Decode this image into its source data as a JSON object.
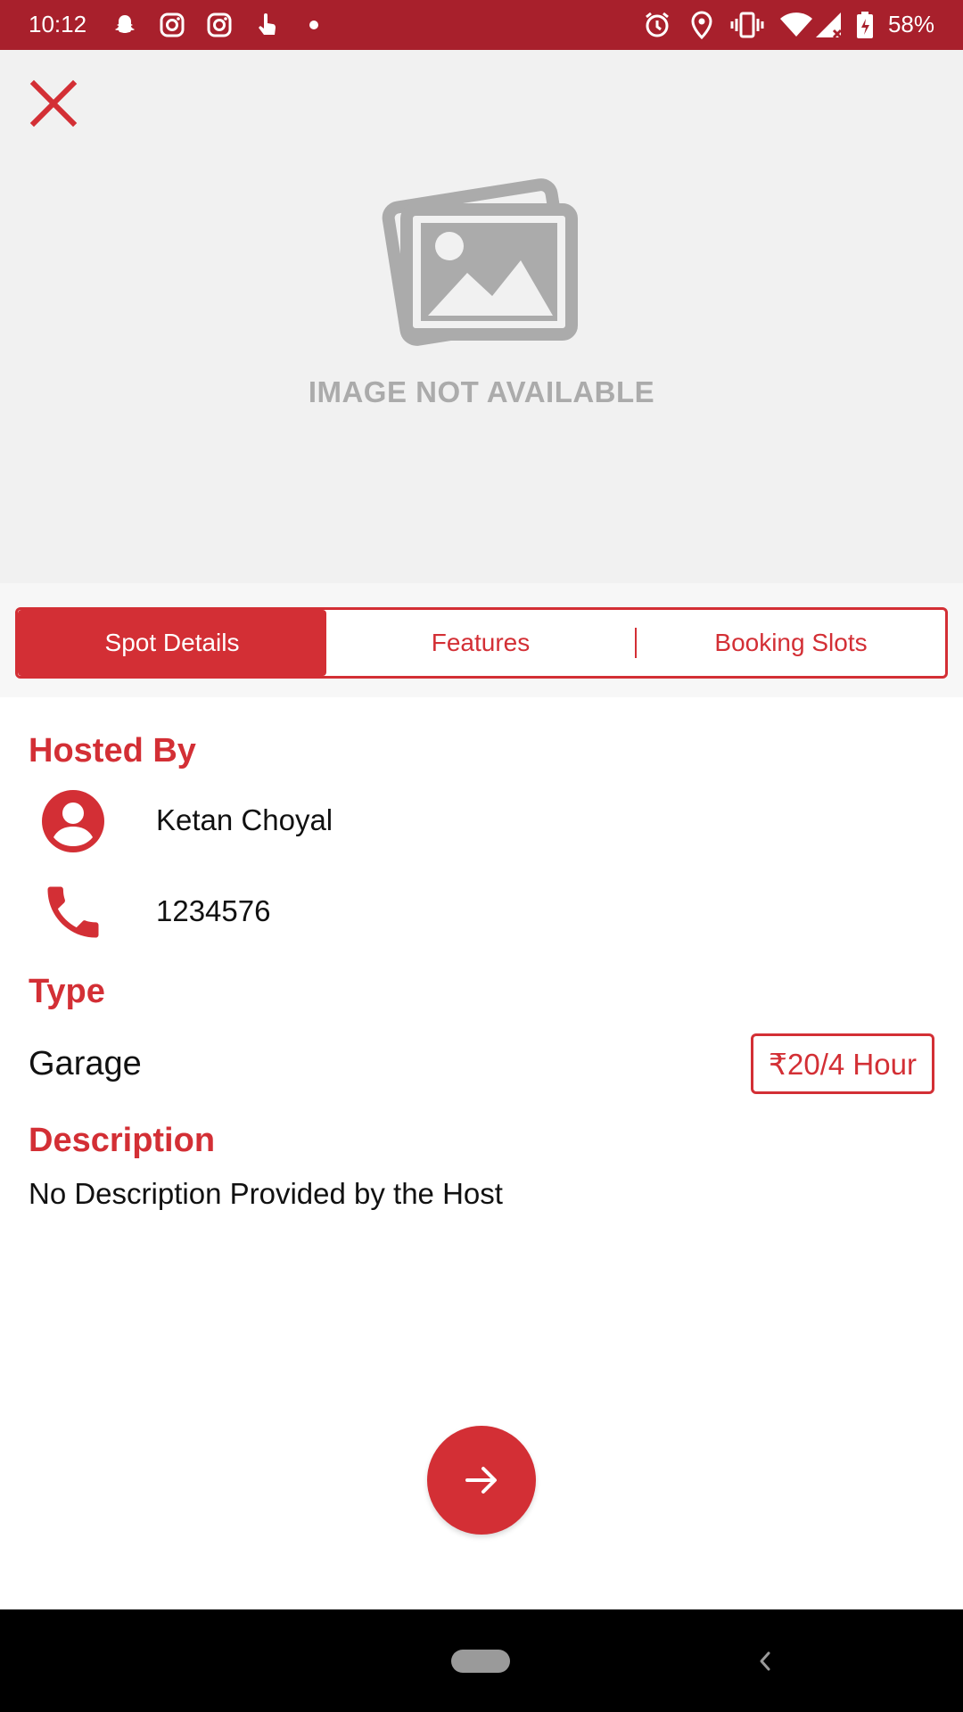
{
  "status_bar": {
    "time": "10:12",
    "battery": "58%",
    "left_icons": [
      "snapchat-icon",
      "instagram-icon",
      "instagram-icon",
      "touch-icon",
      "dot-icon"
    ],
    "right_icons": [
      "alarm-icon",
      "location-icon",
      "vibrate-icon",
      "wifi-icon",
      "signal-icon",
      "battery-icon"
    ]
  },
  "hero": {
    "placeholder_text": "IMAGE NOT AVAILABLE"
  },
  "tabs": [
    {
      "label": "Spot Details",
      "active": true
    },
    {
      "label": "Features",
      "active": false
    },
    {
      "label": "Booking Slots",
      "active": false
    }
  ],
  "details": {
    "hosted_by_title": "Hosted By",
    "host_name": "Ketan Choyal",
    "host_phone": "1234576",
    "type_title": "Type",
    "type_value": "Garage",
    "price": "₹20/4 Hour",
    "description_title": "Description",
    "description_text": "No Description Provided by the Host"
  },
  "colors": {
    "accent": "#d32f35",
    "status_bar": "#a8202c",
    "placeholder_bg": "#f1f1f1",
    "placeholder_gray": "#ababab"
  }
}
